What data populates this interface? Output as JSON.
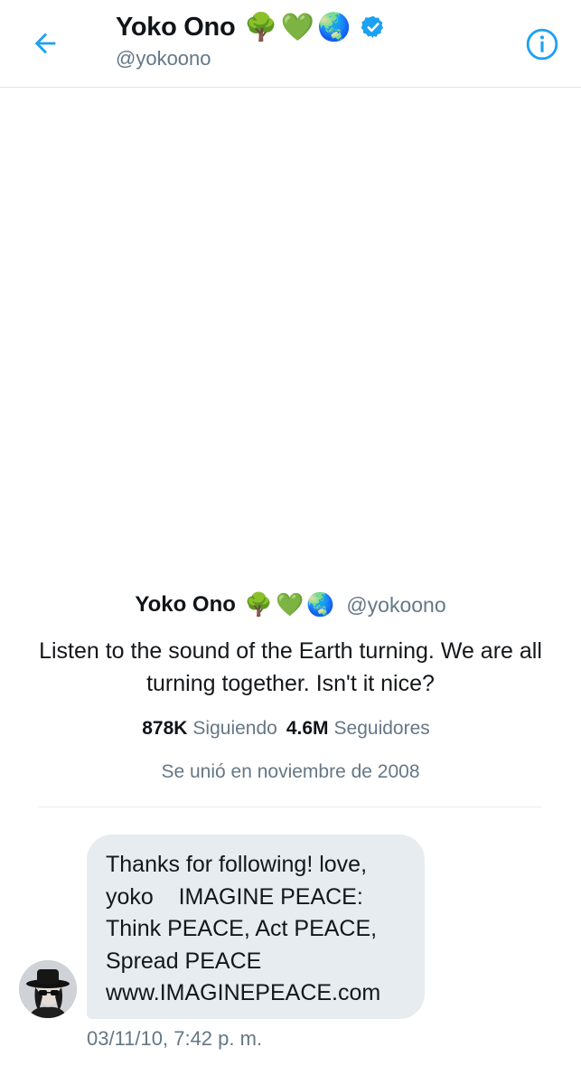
{
  "header": {
    "name": "Yoko Ono",
    "handle": "@yokoono",
    "emoji": [
      "🌳",
      "💚",
      "🌏"
    ]
  },
  "profile": {
    "name": "Yoko Ono",
    "handle": "@yokoono",
    "emoji": [
      "🌳",
      "💚",
      "🌏"
    ],
    "bio": "Listen to the sound of the Earth turning. We are all turning together. Isn't  it nice?",
    "following_count": "878K",
    "following_label": "Siguiendo",
    "followers_count": "4.6M",
    "followers_label": "Seguidores",
    "joined": "Se unió en noviembre de 2008"
  },
  "message": {
    "text": "Thanks for following! love,\nyoko    IMAGINE PEACE:\nThink PEACE, Act PEACE,\nSpread PEACE\nwww.IMAGINEPEACE.com",
    "timestamp": "03/11/10, 7:42 p. m."
  },
  "colors": {
    "accent": "#1da1f2",
    "secondary_text": "#657786",
    "bubble": "#e6ecf0"
  },
  "icons": {
    "back": "back-arrow-icon",
    "info": "info-icon",
    "verified": "verified-badge-icon"
  }
}
